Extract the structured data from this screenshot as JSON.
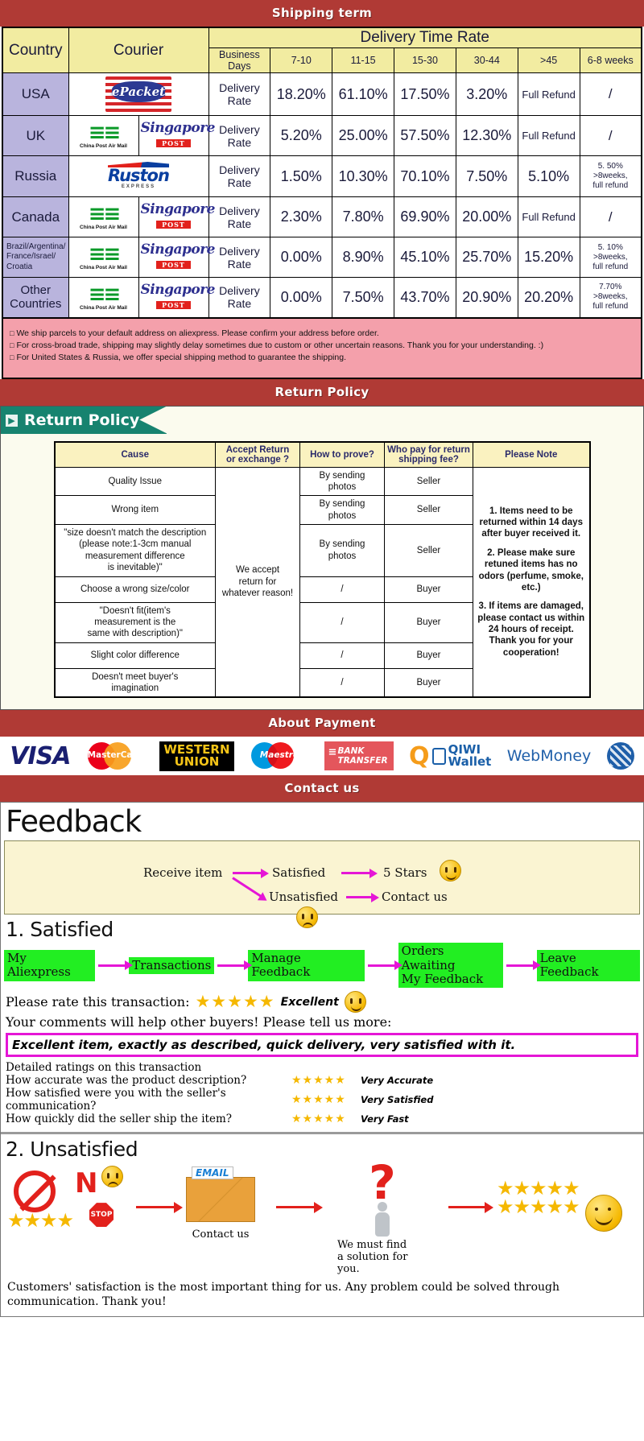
{
  "banners": {
    "shipping": "Shipping term",
    "return": "Return Policy",
    "payment": "About Payment",
    "contact": "Contact us"
  },
  "shipping_table": {
    "headers": {
      "country": "Country",
      "courier": "Courier",
      "delivery_time_rate": "Delivery Time Rate",
      "business_days": "Business Days",
      "ranges": [
        "7-10",
        "11-15",
        "15-30",
        "30-44",
        ">45",
        "6-8 weeks"
      ]
    },
    "rows": [
      {
        "country": "USA",
        "couriers": [
          "epacket-logo"
        ],
        "label": "Delivery Rate",
        "values": [
          "18.20%",
          "61.10%",
          "17.50%",
          "3.20%",
          "Full Refund",
          "/"
        ]
      },
      {
        "country": "UK",
        "couriers": [
          "china-post-air-mail-logo",
          "singapore-post-logo"
        ],
        "label": "Delivery Rate",
        "values": [
          "5.20%",
          "25.00%",
          "57.50%",
          "12.30%",
          "Full Refund",
          "/"
        ]
      },
      {
        "country": "Russia",
        "couriers": [
          "ruston-express-logo"
        ],
        "label": "Delivery Rate",
        "values": [
          "1.50%",
          "10.30%",
          "70.10%",
          "7.50%",
          "5.10%",
          "5. 50%\n>8weeks,\nfull refund"
        ]
      },
      {
        "country": "Canada",
        "couriers": [
          "china-post-air-mail-logo",
          "singapore-post-logo"
        ],
        "label": "Delivery Rate",
        "values": [
          "2.30%",
          "7.80%",
          "69.90%",
          "20.00%",
          "Full Refund",
          "/"
        ]
      },
      {
        "country": "Brazil/Argentina/\nFrance/Israel/\nCroatia",
        "couriers": [
          "china-post-air-mail-logo",
          "singapore-post-logo"
        ],
        "label": "Delivery Rate",
        "values": [
          "0.00%",
          "8.90%",
          "45.10%",
          "25.70%",
          "15.20%",
          "5. 10%\n>8weeks,\nfull refund"
        ]
      },
      {
        "country": "Other Countries",
        "couriers": [
          "china-post-air-mail-logo",
          "singapore-post-logo"
        ],
        "label": "Delivery Rate",
        "values": [
          "0.00%",
          "7.50%",
          "43.70%",
          "20.90%",
          "20.20%",
          "7.70%\n>8weeks,\nfull refund"
        ]
      }
    ],
    "logo_text": {
      "epacket": "ePacket",
      "china_post": "China Post Air Mail",
      "singapore": "Singapore",
      "singapore_post": "POST",
      "ruston": "Ruston",
      "ruston_sub": "EXPRESS"
    },
    "notes": [
      "We ship parcels to your default address on aliexpress. Please confirm your address before order.",
      "For cross-broad trade, shipping may slightly delay sometimes due to custom or other uncertain reasons. Thank you for your understanding. :)",
      "For United States & Russia, we offer special shipping method to guarantee the shipping."
    ]
  },
  "return_policy": {
    "tab_label": "Return Policy",
    "tab_icon": "arrow-right-icon",
    "headers": [
      "Cause",
      "Accept Return\nor exchange ?",
      "How to prove?",
      "Who pay for return\nshipping fee?",
      "Please Note"
    ],
    "accept_cell": "We accept\nreturn for\nwhatever reason!",
    "rows": [
      {
        "cause": "Quality Issue",
        "prove": "By sending\nphotos",
        "pay": "Seller"
      },
      {
        "cause": "Wrong item",
        "prove": "By sending\nphotos",
        "pay": "Seller"
      },
      {
        "cause": "\"size doesn't match the description\n(please note:1-3cm manual\nmeasurement difference\nis inevitable)\"",
        "prove": "By sending\nphotos",
        "pay": "Seller"
      },
      {
        "cause": "Choose a wrong size/color",
        "prove": "/",
        "pay": "Buyer"
      },
      {
        "cause": "\"Doesn't fit(item's\nmeasurement is the\nsame with description)\"",
        "prove": "/",
        "pay": "Buyer"
      },
      {
        "cause": "Slight color difference",
        "prove": "/",
        "pay": "Buyer"
      },
      {
        "cause": "Doesn't meet buyer's\nimagination",
        "prove": "/",
        "pay": "Buyer"
      }
    ],
    "notes": [
      "1. Items need to be returned within 14 days after buyer received it.",
      "2. Please make sure retuned items has no odors (perfume, smoke, etc.)",
      "3. If items are damaged, please contact us within 24 hours of receipt.\nThank you for your cooperation!"
    ]
  },
  "payment": {
    "methods": [
      {
        "name": "visa-logo",
        "label": "VISA"
      },
      {
        "name": "mastercard-logo",
        "label": "MasterCard"
      },
      {
        "name": "western-union-logo",
        "label": "WESTERN",
        "label2": "UNION"
      },
      {
        "name": "maestro-logo",
        "label": "Maestro"
      },
      {
        "name": "bank-transfer-logo",
        "label": "BANK",
        "label2": "TRANSFER"
      },
      {
        "name": "qiwi-wallet-logo",
        "label": "QIWI",
        "label2": "Wallet"
      },
      {
        "name": "webmoney-logo",
        "label": "WebMoney"
      }
    ]
  },
  "feedback": {
    "title": "Feedback",
    "flow": {
      "receive": "Receive item",
      "satisfied": "Satisfied",
      "five_stars": "5 Stars",
      "unsatisfied": "Unsatisfied",
      "contact_us": "Contact us"
    },
    "satisfied": {
      "heading": "1. Satisfied",
      "steps": [
        "My Aliexpress",
        "Transactions",
        "Manage Feedback",
        "Orders Awaiting\nMy Feedback",
        "Leave Feedback"
      ],
      "rate_prompt": "Please rate this transaction:",
      "stars": "★★★★★",
      "rating_word": "Excellent",
      "comment_prompt": "Your comments will help other buyers! Please tell us more:",
      "comment_text": "Excellent item, exactly as described, quick delivery, very satisfied with it.",
      "detailed_heading": "Detailed ratings on this transaction",
      "detailed": [
        {
          "question": "How accurate was the product description?",
          "stars": "★★★★★",
          "label": "Very Accurate"
        },
        {
          "question": "How satisfied were you with the seller's communication?",
          "stars": "★★★★★",
          "label": "Very Satisfied"
        },
        {
          "question": "How quickly did the seller ship the item?",
          "stars": "★★★★★",
          "label": "Very Fast"
        }
      ]
    },
    "unsatisfied": {
      "heading": "2. Unsatisfied",
      "bad_stars": "★★★★",
      "no_text": "N",
      "stop_text": "STOP",
      "email_tag": "EMAIL",
      "contact_caption": "Contact us",
      "solution_caption": "We must find\na solution for\nyou.",
      "good_stars": "★★★★★",
      "closing": "Customers' satisfaction is the most important thing for us. Any problem could be solved through communication. Thank you!"
    }
  },
  "colors": {
    "banner_red": "#b03a35",
    "header_yellow": "#f2eca1",
    "country_purple": "#b9b4dd",
    "note_pink": "#f4a0ab",
    "tab_teal": "#17836f",
    "chip_green": "#22ee22",
    "arrow_magenta": "#e516d6",
    "star_gold": "#f5b800"
  }
}
